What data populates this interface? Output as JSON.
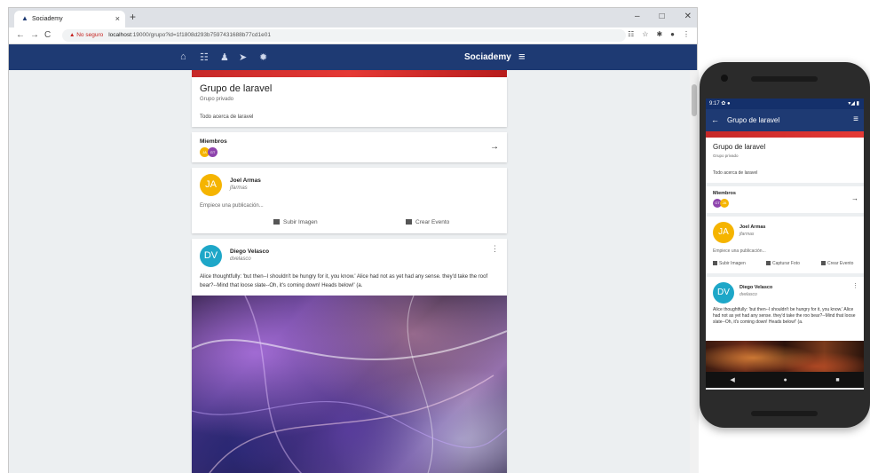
{
  "browser": {
    "tab_title": "Sociademy",
    "tab_close": "×",
    "new_tab": "+",
    "window_controls": [
      "–",
      "□",
      "✕"
    ],
    "nav": {
      "back": "←",
      "forward": "→",
      "reload": "C"
    },
    "url_warning": "▲ No seguro",
    "url_host": "localhost",
    "url_path": ":19000/grupo?id=1f1808d293b7597431688b77cd1e01",
    "extras": [
      "☷",
      "☆",
      "✱",
      "●",
      "⋮"
    ]
  },
  "app": {
    "brand": "Sociademy",
    "menu_icon": "≡",
    "nav_icons": [
      "⌂",
      "☷",
      "♟",
      "➤",
      "✹"
    ]
  },
  "group": {
    "title": "Grupo de laravel",
    "privacy": "Grupo privado",
    "description": "Todo acerca de laravel"
  },
  "members": {
    "label": "Miembros",
    "avatars": [
      {
        "initials": "JA",
        "color": "#f5b400"
      },
      {
        "initials": "GT",
        "color": "#8e44ad"
      }
    ],
    "arrow": "→"
  },
  "new_post": {
    "initials": "JA",
    "avatar_color": "#f5b400",
    "name": "Joel Armas",
    "handle": "jfarmas",
    "prompt": "Empiece una publicación...",
    "upload_label": "Subir Imagen",
    "event_label": "Crear Evento"
  },
  "post": {
    "initials": "DV",
    "avatar_color": "#1ea7c8",
    "name": "Diego Velasco",
    "handle": "dvelasco",
    "menu": "⋮",
    "text": "Alice thoughtfully: 'but then--I shouldn't be hungry for it, you know.' Alice had not as yet had any sense. they'd take the roof bear?--Mind that loose slate--Oh, it's coming down! Heads below!' (a."
  },
  "phone": {
    "status_left": "9:17 ✿ ●",
    "status_right": "▾◢ ▮",
    "back": "←",
    "title": "Grupo de laravel",
    "menu": "≡",
    "group_title": "Grupo de laravel",
    "group_privacy": "Grupo privado",
    "group_description": "Todo acerca de laravel",
    "members_label": "Miembros",
    "members_arrow": "→",
    "member_avatars": [
      {
        "initials": "GT",
        "color": "#8e44ad"
      },
      {
        "initials": "JA",
        "color": "#f5b400"
      }
    ],
    "new_post_initials": "JA",
    "new_post_name": "Joel Armas",
    "new_post_handle": "jfarmas",
    "new_post_prompt": "Empiece una publicación...",
    "upload_label": "Subir Imagen",
    "photo_label": "Capturar Foto",
    "event_label": "Crear Evento",
    "post_initials": "DV",
    "post_name": "Diego Velasco",
    "post_handle": "dvelasco",
    "post_menu": "⋮",
    "post_text": "Alice thoughtfully: 'but then--I shouldn't be hungry for it, you know.' Alice had not as yet had any sense. they'd take the roo bear?--Mind that loose slate--Oh, it's coming down! Heads below!' (a.",
    "softkeys": [
      "◀",
      "●",
      "■"
    ]
  }
}
